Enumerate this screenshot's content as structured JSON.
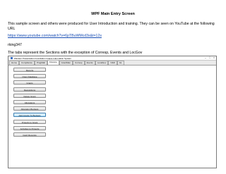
{
  "doc": {
    "title": "WPF Main Entry Screen",
    "intro": "This sample screen and others were produced for User Introduction and training. They can be seen on YouTube at the following URL",
    "link": "https://www.youtube.com/watch?v=6pTBuWMcd3s&t=12s",
    "user": "rking347",
    "tabs_note": "The tabs represent the Sections  with the exception of Corresp, Events and LocGov"
  },
  "app": {
    "title": "Windsor Presentation Foundation Grants Information System",
    "tabs": [
      "Home",
      "Compliance",
      "ProgMatl",
      "Finance",
      "GrantMan",
      "Corresp",
      "Events",
      "LocalGov",
      "NAR",
      "GL"
    ],
    "active_tab_index": 3,
    "buttons": [
      "Reports",
      "Open Database",
      "Grants",
      "Requisitions",
      "Delete Grant",
      "Allocations",
      "Allocation Budgets",
      "Add Grants To Budgets",
      "Projects to Grant",
      "Activities to Projects",
      "Cash Receipts"
    ]
  }
}
